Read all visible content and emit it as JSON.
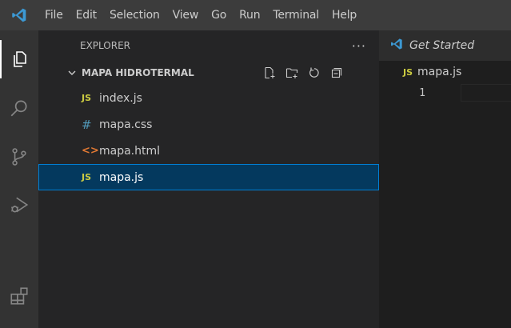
{
  "menubar": {
    "logo_icon": "vscode-logo-icon",
    "items": [
      "File",
      "Edit",
      "Selection",
      "View",
      "Go",
      "Run",
      "Terminal",
      "Help"
    ]
  },
  "activitybar": {
    "items": [
      "explorer-icon",
      "search-icon",
      "source-control-icon",
      "run-debug-icon",
      "extensions-icon"
    ]
  },
  "sidebar": {
    "title": "EXPLORER",
    "more_label": "···",
    "folder": {
      "name": "MAPA HIDROTERMAL",
      "actions": [
        "new-file-icon",
        "new-folder-icon",
        "refresh-icon",
        "collapse-all-icon"
      ]
    },
    "files": [
      {
        "icon": "JS",
        "type": "js",
        "name": "index.js"
      },
      {
        "icon": "#",
        "type": "css",
        "name": "mapa.css"
      },
      {
        "icon": "<>",
        "type": "html",
        "name": "mapa.html"
      },
      {
        "icon": "JS",
        "type": "js",
        "name": "mapa.js",
        "selected": true
      }
    ]
  },
  "editor": {
    "tab_label": "Get Started",
    "breadcrumb_icon": "JS",
    "breadcrumb_file": "mapa.js",
    "line_number": "1"
  },
  "colors": {
    "accent": "#007fd4",
    "selection_bg": "#04395e",
    "js_yellow": "#cbcb41",
    "css_blue": "#519aba",
    "html_orange": "#e37933",
    "vscode_blue": "#3c99d4"
  }
}
